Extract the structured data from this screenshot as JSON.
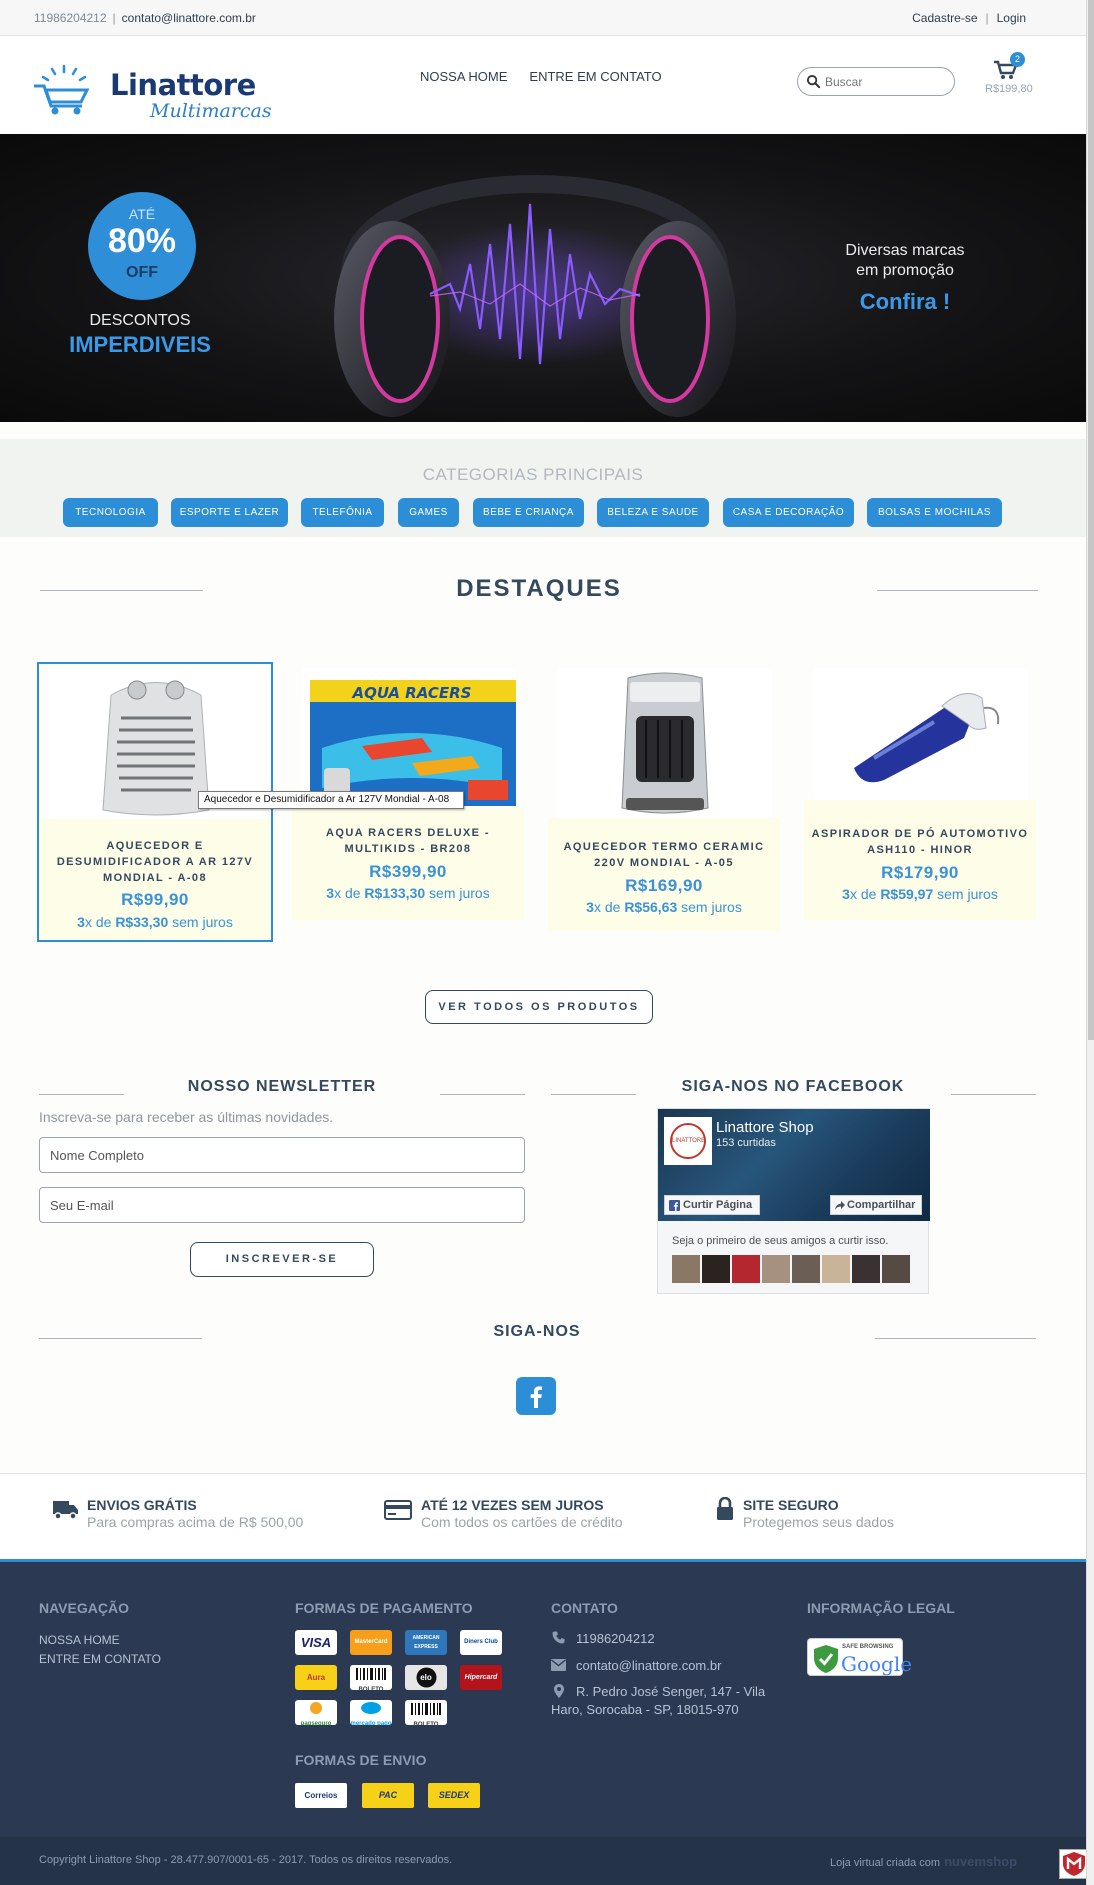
{
  "topbar": {
    "phone": "11986204212",
    "separator": "|",
    "email": "contato@linattore.com.br",
    "register": "Cadastre-se",
    "login": "Login"
  },
  "header": {
    "logo_name": "Linattore",
    "logo_tagline": "Multimarcas",
    "nav": [
      "NOSSA HOME",
      "ENTRE EM CONTATO"
    ],
    "search_placeholder": "Buscar",
    "cart_count": "2",
    "cart_total": "R$199,80"
  },
  "banner": {
    "discount_prefix": "ATÉ",
    "discount_pct": "80%",
    "discount_off": "OFF",
    "left_line1": "DESCONTOS",
    "left_line2": "IMPERDIVEIS",
    "right_line1": "Diversas marcas",
    "right_line2": "em promoção",
    "right_cta": "Confira !"
  },
  "categories": {
    "title": "CATEGORIAS PRINCIPAIS",
    "items": [
      "TECNOLOGIA",
      "ESPORTE E LAZER",
      "TELEFÔNIA",
      "GAMES",
      "BEBE E CRIANÇA",
      "BELEZA E SAUDE",
      "CASA E DECORAÇÃO",
      "BOLSAS E MOCHILAS"
    ]
  },
  "featured": {
    "title": "DESTAQUES",
    "products": [
      {
        "name_lines": [
          "AQUECEDOR E",
          "DESUMIDIFICADOR A AR 127V",
          "MONDIAL - A-08"
        ],
        "price": "R$99,90",
        "installments_n": "3",
        "installments_mid": "x de ",
        "installments_value": "R$33,30",
        "installments_suffix": " sem juros"
      },
      {
        "name_lines": [
          "AQUA RACERS DELUXE -",
          "MULTIKIDS - BR208"
        ],
        "price": "R$399,90",
        "installments_n": "3",
        "installments_mid": "x de ",
        "installments_value": "R$133,30",
        "installments_suffix": " sem juros"
      },
      {
        "name_lines": [
          "AQUECEDOR TERMO CERAMIC",
          "220V MONDIAL - A-05"
        ],
        "price": "R$169,90",
        "installments_n": "3",
        "installments_mid": "x de ",
        "installments_value": "R$56,63",
        "installments_suffix": " sem juros"
      },
      {
        "name_lines": [
          "ASPIRADOR DE PÓ AUTOMOTIVO",
          "ASH110 - HINOR"
        ],
        "price": "R$179,90",
        "installments_n": "3",
        "installments_mid": "x de ",
        "installments_value": "R$59,97",
        "installments_suffix": " sem juros"
      }
    ],
    "tooltip": "Aquecedor e Desumidificador a Ar 127V Mondial - A-08",
    "view_all": "VER TODOS OS PRODUTOS"
  },
  "newsletter": {
    "title": "NOSSO NEWSLETTER",
    "subtitle": "Inscreva-se para receber as últimas novidades.",
    "name_placeholder": "Nome Completo",
    "email_placeholder": "Seu E-mail",
    "submit": "INSCREVER-SE"
  },
  "facebook": {
    "title": "SIGA-NOS NO FACEBOOK",
    "page_name": "Linattore Shop",
    "likes": "153 curtidas",
    "like_btn": "Curtir Página",
    "share_btn": "Compartilhar",
    "friends_text": "Seja o primeiro de seus amigos a curtir isso.",
    "logo_text": "LINATTORE"
  },
  "follow": {
    "title": "SIGA-NOS"
  },
  "features": [
    {
      "title": "ENVIOS GRÁTIS",
      "subtitle": "Para compras acima de R$ 500,00",
      "icon": "truck-icon"
    },
    {
      "title": "ATÉ 12 VEZES SEM JUROS",
      "subtitle": "Com todos os cartões de crédito",
      "icon": "credit-card-icon"
    },
    {
      "title": "SITE SEGURO",
      "subtitle": "Protegemos seus dados",
      "icon": "lock-icon"
    }
  ],
  "footer": {
    "nav_title": "NAVEGAÇÃO",
    "nav_links": [
      "NOSSA HOME",
      "ENTRE EM CONTATO"
    ],
    "payment_title": "FORMAS DE PAGAMENTO",
    "payments": [
      "VISA",
      "MasterCard",
      "AMERICAN EXPRESS",
      "Diners Club",
      "Aura",
      "BOLETO",
      "elo",
      "Hipercard",
      "pagseguro",
      "mercado pago",
      "BOLETO"
    ],
    "shipping_title": "FORMAS DE ENVIO",
    "shipping": [
      "Correios",
      "PAC",
      "SEDEX"
    ],
    "contact_title": "CONTATO",
    "phone": "11986204212",
    "email": "contato@linattore.com.br",
    "address_line1": "R. Pedro José Senger, 147 - Vila",
    "address_line2": "Haro, Sorocaba - SP, 18015-970",
    "legal_title": "INFORMAÇÃO LEGAL",
    "safe_browsing": "SAFE BROWSING",
    "google": "Google"
  },
  "copyright": {
    "text": "Copyright Linattore Shop - 28.477.907/0001-65 - 2017. Todos os direitos reservados.",
    "made_by": "Loja virtual criada com",
    "platform": "nuvemshop"
  },
  "colors": {
    "accent": "#2d8ed8",
    "dark": "#34495e",
    "footer": "#2b3a52"
  }
}
